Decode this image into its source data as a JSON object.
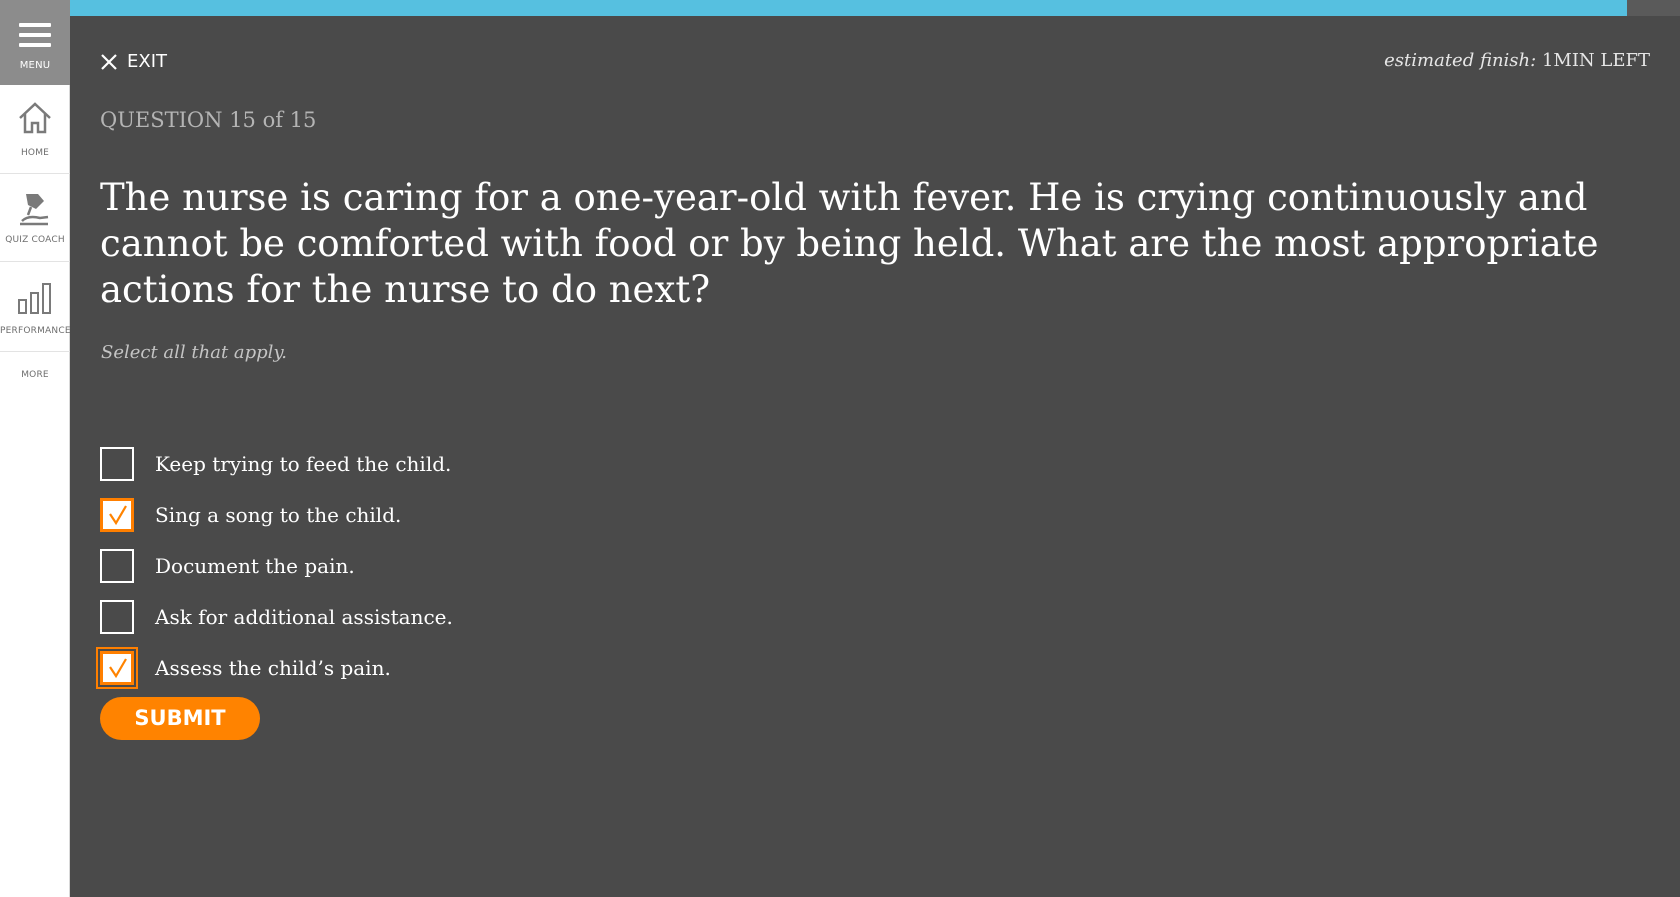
{
  "sidebar": {
    "menu_label": "MENU",
    "items": [
      {
        "label": "HOME",
        "icon": "home-icon"
      },
      {
        "label": "QUIZ COACH",
        "icon": "quiz-coach-icon"
      },
      {
        "label": "PERFORMANCE",
        "icon": "performance-icon"
      },
      {
        "label": "MORE"
      }
    ]
  },
  "progress": {
    "fraction": 0.967,
    "color": "#56c0e0"
  },
  "header": {
    "exit_label": "EXIT",
    "estimate_label": "estimated finish:",
    "estimate_value": "1MIN LEFT"
  },
  "question": {
    "number_label": "QUESTION 15 of 15",
    "text": "The nurse is caring for a one-year-old with fever. He is crying continuously and cannot be comforted with food or by being held. What are the most appropriate actions for the nurse to do next?",
    "hint": "Select all that apply.",
    "options": [
      {
        "label": "Keep trying to feed the child.",
        "checked": false
      },
      {
        "label": "Sing a song to the child.",
        "checked": true
      },
      {
        "label": "Document the pain.",
        "checked": false
      },
      {
        "label": "Ask for additional assistance.",
        "checked": false
      },
      {
        "label": "Assess the child’s pain.",
        "checked": true,
        "focused": true
      }
    ]
  },
  "submit_label": "SUBMIT",
  "colors": {
    "accent": "#ff8300",
    "background": "#4a4a4a",
    "progress": "#56c0e0"
  }
}
